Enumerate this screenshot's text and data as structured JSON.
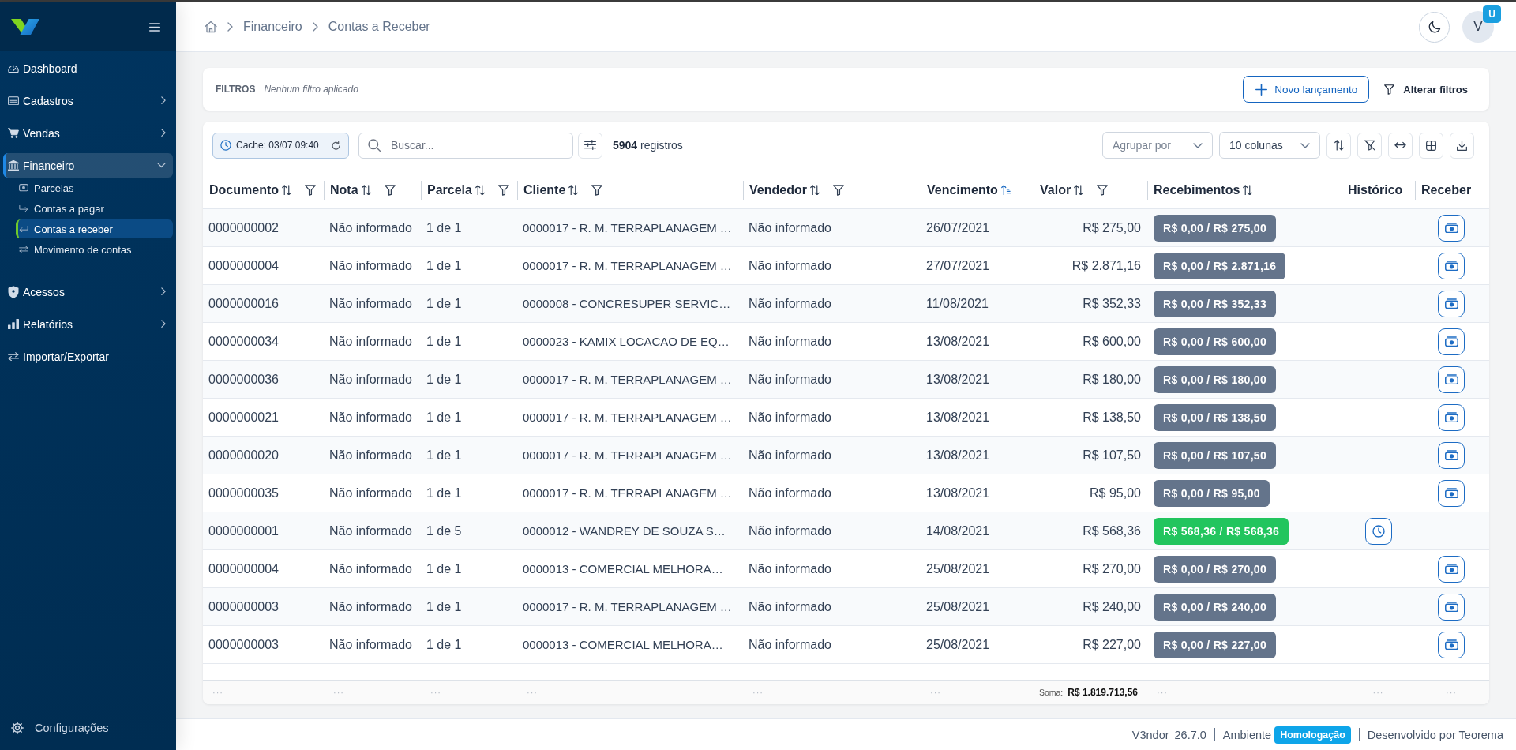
{
  "sidebar": {
    "items": [
      {
        "label": "Dashboard",
        "expandable": false,
        "expanded": false
      },
      {
        "label": "Cadastros",
        "expandable": true,
        "expanded": false
      },
      {
        "label": "Vendas",
        "expandable": true,
        "expanded": false
      },
      {
        "label": "Financeiro",
        "expandable": true,
        "expanded": true,
        "children": [
          {
            "label": "Parcelas",
            "selected": false
          },
          {
            "label": "Contas a pagar",
            "selected": false
          },
          {
            "label": "Contas a receber",
            "selected": true
          },
          {
            "label": "Movimento de contas",
            "selected": false
          }
        ]
      },
      {
        "label": "Acessos",
        "expandable": true,
        "expanded": false
      },
      {
        "label": "Relatórios",
        "expandable": true,
        "expanded": false
      },
      {
        "label": "Importar/Exportar",
        "expandable": false,
        "expanded": false
      }
    ],
    "settings": {
      "label": "Configurações"
    }
  },
  "header": {
    "breadcrumb": [
      "Financeiro",
      "Contas a Receber"
    ],
    "user": {
      "initial": "V",
      "badge": "U"
    }
  },
  "filters": {
    "title": "FILTROS",
    "summary": "Nenhum filtro aplicado",
    "actions": [
      {
        "label": "Novo lançamento",
        "kind": "primary"
      },
      {
        "label": "Alterar filtros",
        "kind": "plain"
      }
    ]
  },
  "toolbar": {
    "cache": "Cache: 03/07 09:40",
    "search": {
      "placeholder": "Buscar..."
    },
    "count": "**5904** registros",
    "group_by": {
      "placeholder": "Agrupar por"
    },
    "columns": {
      "value": "10 colunas"
    }
  },
  "table": {
    "columns": [
      {
        "label": "Documento",
        "sortable": true,
        "sorted": false,
        "filterable": true
      },
      {
        "label": "Nota",
        "sortable": true,
        "sorted": false,
        "filterable": true
      },
      {
        "label": "Parcela",
        "sortable": true,
        "sorted": false,
        "filterable": true
      },
      {
        "label": "Cliente",
        "sortable": true,
        "sorted": false,
        "filterable": true
      },
      {
        "label": "Vendedor",
        "sortable": true,
        "sorted": false,
        "filterable": true
      },
      {
        "label": "Vencimento",
        "sortable": true,
        "sorted": true,
        "filterable": false
      },
      {
        "label": "Valor",
        "sortable": true,
        "sorted": false,
        "filterable": true
      },
      {
        "label": "Recebimentos",
        "sortable": true,
        "sorted": false,
        "filterable": false
      },
      {
        "label": "Histórico",
        "sortable": false,
        "sorted": false,
        "filterable": false
      },
      {
        "label": "Receber",
        "sortable": false,
        "sorted": false,
        "filterable": false
      }
    ],
    "rows": [
      {
        "documento": "0000000002",
        "nota": "Não informado",
        "parcela": "1 de 1",
        "cliente": "0000017 - R. M. TERRAPLANAGEM …",
        "vendedor": "Não informado",
        "vencimento": "26/07/2021",
        "valor": "R$ 275,00",
        "receipt": {
          "text": "R$ 0,00 / R$ 275,00",
          "color": "#64748b"
        },
        "kind": "open"
      },
      {
        "documento": "0000000004",
        "nota": "Não informado",
        "parcela": "1 de 1",
        "cliente": "0000017 - R. M. TERRAPLANAGEM …",
        "vendedor": "Não informado",
        "vencimento": "27/07/2021",
        "valor": "R$ 2.871,16",
        "receipt": {
          "text": "R$ 0,00 / R$ 2.871,16",
          "color": "#64748b"
        },
        "kind": "open"
      },
      {
        "documento": "0000000016",
        "nota": "Não informado",
        "parcela": "1 de 1",
        "cliente": "0000008 - CONCRESUPER SERVIC…",
        "vendedor": "Não informado",
        "vencimento": "11/08/2021",
        "valor": "R$ 352,33",
        "receipt": {
          "text": "R$ 0,00 / R$ 352,33",
          "color": "#64748b"
        },
        "kind": "open"
      },
      {
        "documento": "0000000034",
        "nota": "Não informado",
        "parcela": "1 de 1",
        "cliente": "0000023 - KAMIX LOCACAO DE EQ…",
        "vendedor": "Não informado",
        "vencimento": "13/08/2021",
        "valor": "R$ 600,00",
        "receipt": {
          "text": "R$ 0,00 / R$ 600,00",
          "color": "#64748b"
        },
        "kind": "open"
      },
      {
        "documento": "0000000036",
        "nota": "Não informado",
        "parcela": "1 de 1",
        "cliente": "0000017 - R. M. TERRAPLANAGEM …",
        "vendedor": "Não informado",
        "vencimento": "13/08/2021",
        "valor": "R$ 180,00",
        "receipt": {
          "text": "R$ 0,00 / R$ 180,00",
          "color": "#64748b"
        },
        "kind": "open"
      },
      {
        "documento": "0000000021",
        "nota": "Não informado",
        "parcela": "1 de 1",
        "cliente": "0000017 - R. M. TERRAPLANAGEM …",
        "vendedor": "Não informado",
        "vencimento": "13/08/2021",
        "valor": "R$ 138,50",
        "receipt": {
          "text": "R$ 0,00 / R$ 138,50",
          "color": "#64748b"
        },
        "kind": "open"
      },
      {
        "documento": "0000000020",
        "nota": "Não informado",
        "parcela": "1 de 1",
        "cliente": "0000017 - R. M. TERRAPLANAGEM …",
        "vendedor": "Não informado",
        "vencimento": "13/08/2021",
        "valor": "R$ 107,50",
        "receipt": {
          "text": "R$ 0,00 / R$ 107,50",
          "color": "#64748b"
        },
        "kind": "open"
      },
      {
        "documento": "0000000035",
        "nota": "Não informado",
        "parcela": "1 de 1",
        "cliente": "0000017 - R. M. TERRAPLANAGEM …",
        "vendedor": "Não informado",
        "vencimento": "13/08/2021",
        "valor": "R$ 95,00",
        "receipt": {
          "text": "R$ 0,00 / R$ 95,00",
          "color": "#64748b"
        },
        "kind": "open"
      },
      {
        "documento": "0000000001",
        "nota": "Não informado",
        "parcela": "1 de 5",
        "cliente": "0000012 - WANDREY DE SOUZA S…",
        "vendedor": "Não informado",
        "vencimento": "14/08/2021",
        "valor": "R$ 568,36",
        "receipt": {
          "text": "R$ 568,36 / R$ 568,36",
          "color": "#22c55e"
        },
        "kind": "paid"
      },
      {
        "documento": "0000000004",
        "nota": "Não informado",
        "parcela": "1 de 1",
        "cliente": "0000013 - COMERCIAL MELHORA…",
        "vendedor": "Não informado",
        "vencimento": "25/08/2021",
        "valor": "R$ 270,00",
        "receipt": {
          "text": "R$ 0,00 / R$ 270,00",
          "color": "#64748b"
        },
        "kind": "open"
      },
      {
        "documento": "0000000003",
        "nota": "Não informado",
        "parcela": "1 de 1",
        "cliente": "0000017 - R. M. TERRAPLANAGEM …",
        "vendedor": "Não informado",
        "vencimento": "25/08/2021",
        "valor": "R$ 240,00",
        "receipt": {
          "text": "R$ 0,00 / R$ 240,00",
          "color": "#64748b"
        },
        "kind": "open"
      },
      {
        "documento": "0000000003",
        "nota": "Não informado",
        "parcela": "1 de 1",
        "cliente": "0000013 - COMERCIAL MELHORA…",
        "vendedor": "Não informado",
        "vencimento": "25/08/2021",
        "valor": "R$ 227,00",
        "receipt": {
          "text": "R$ 0,00 / R$ 227,00",
          "color": "#64748b"
        },
        "kind": "open"
      }
    ],
    "totals": [
      {
        "value": "···"
      },
      {
        "value": "···"
      },
      {
        "value": "···"
      },
      {
        "value": "···"
      },
      {
        "value": "···"
      },
      {
        "value": "···"
      },
      {
        "label": "Soma:",
        "value": "R$ 1.819.713,56"
      },
      {
        "value": "···"
      },
      {
        "value": "···"
      },
      {
        "value": "···"
      }
    ]
  },
  "status_bar": {
    "app": "V3ndor",
    "version": "26.7.0",
    "environment_label": "Ambiente",
    "environment": "Homologação",
    "credit": "Desenvolvido por Teorema"
  }
}
